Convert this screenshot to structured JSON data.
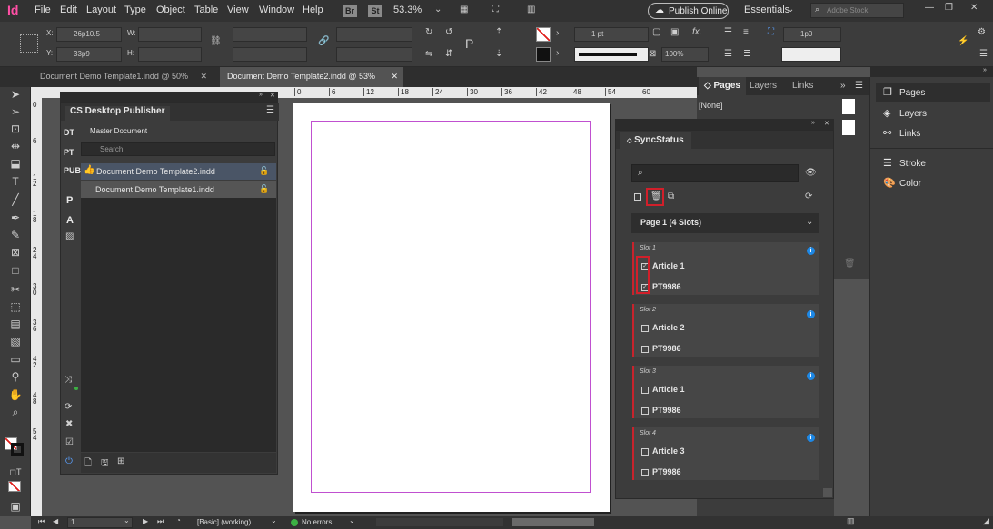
{
  "app": {
    "logo": "Id",
    "menu": [
      "File",
      "Edit",
      "Layout",
      "Type",
      "Object",
      "Table",
      "View",
      "Window",
      "Help"
    ],
    "bridge": "Br",
    "stock": "St",
    "zoom": "53.3%",
    "publish_online": "Publish Online",
    "workspace": "Essentials",
    "search_placeholder": "Adobe Stock"
  },
  "control": {
    "x_label": "X:",
    "x_value": "26p10.5",
    "y_label": "Y:",
    "y_value": "33p9",
    "w_label": "W:",
    "h_label": "H:",
    "stroke_weight": "1 pt",
    "opacity": "100%",
    "gap_value": "1p0"
  },
  "doc_tabs": [
    {
      "label": "Document Demo Template1.indd @ 50%"
    },
    {
      "label": "Document Demo Template2.indd @ 53%"
    }
  ],
  "rulers": {
    "h": [
      "0",
      "6",
      "12",
      "18",
      "24",
      "30",
      "36",
      "42",
      "48",
      "54",
      "60"
    ],
    "v": [
      "0",
      "6",
      "1 2",
      "1 8",
      "2 4",
      "3 0",
      "3 6",
      "4 2",
      "4 8",
      "5 4"
    ]
  },
  "publisher": {
    "title": "CS Desktop Publisher",
    "side": [
      "DT",
      "PT",
      "PUB",
      "P",
      "A"
    ],
    "section": "Master Document",
    "search_placeholder": "Search",
    "docs": [
      "Document Demo Template2.indd",
      "Document Demo Template1.indd"
    ]
  },
  "sync": {
    "title": "SyncStatus",
    "page_select": "Page 1 (4 Slots)",
    "slots": [
      {
        "label": "Slot 1",
        "items": [
          "Article 1",
          "PT9986"
        ],
        "checked": [
          true,
          true
        ]
      },
      {
        "label": "Slot 2",
        "items": [
          "Article 2",
          "PT9986"
        ],
        "checked": [
          false,
          false
        ]
      },
      {
        "label": "Slot 3",
        "items": [
          "Article 1",
          "PT9986"
        ],
        "checked": [
          false,
          false
        ]
      },
      {
        "label": "Slot 4",
        "items": [
          "Article 3",
          "PT9986"
        ],
        "checked": [
          false,
          false
        ]
      }
    ]
  },
  "pages_panel": {
    "tabs": [
      "Pages",
      "Layers",
      "Links"
    ],
    "none_label": "[None]"
  },
  "dock": [
    "Pages",
    "Layers",
    "Links",
    "Stroke",
    "Color"
  ],
  "status": {
    "page": "1",
    "style": "[Basic] (working)",
    "errors": "No errors"
  },
  "colors": {
    "accent": "#1e88e5",
    "highlight": "#d21f2a",
    "error_ok": "#3cb043"
  }
}
